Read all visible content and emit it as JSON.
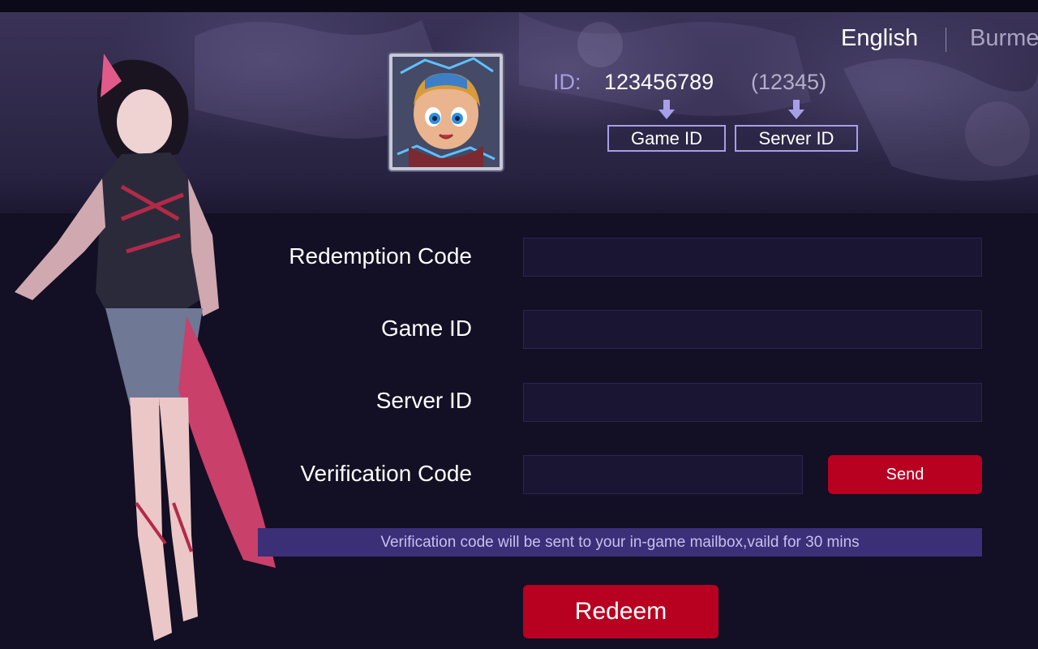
{
  "language": {
    "current": "English",
    "other": "Burme"
  },
  "profile": {
    "id_label": "ID:",
    "game_id": "123456789",
    "server_id": "(12345)",
    "game_id_tag": "Game ID",
    "server_id_tag": "Server ID",
    "avatar_icon": "hero-portrait-icon"
  },
  "form": {
    "redemption_code_label": "Redemption Code",
    "game_id_label": "Game ID",
    "server_id_label": "Server ID",
    "verification_code_label": "Verification Code",
    "redemption_code_value": "",
    "game_id_value": "",
    "server_id_value": "",
    "verification_code_value": "",
    "send_label": "Send",
    "notice": "Verification code will be sent to your in-game mailbox,vaild for 30 mins",
    "redeem_label": "Redeem"
  },
  "colors": {
    "accent_red": "#b80021",
    "accent_purple": "#a79fe8",
    "background": "#130f24"
  }
}
